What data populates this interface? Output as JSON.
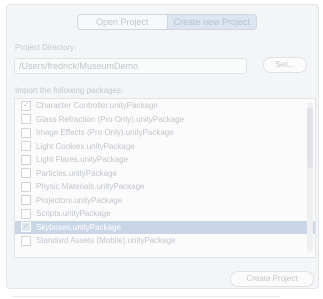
{
  "tabs": [
    {
      "label": "Open Project",
      "active": false
    },
    {
      "label": "Create new Project",
      "active": true
    }
  ],
  "project_directory": {
    "label": "Project Directory:",
    "value": "/Users/fredrick/MuseumDemo",
    "set_label": "Set..."
  },
  "packages": {
    "label": "Import the following packages:",
    "items": [
      {
        "label": "Character Controller.unityPackage",
        "checked": true,
        "selected": false
      },
      {
        "label": "Glass Refraction (Pro Only).unityPackage",
        "checked": false,
        "selected": false
      },
      {
        "label": "Image Effects (Pro Only).unityPackage",
        "checked": false,
        "selected": false
      },
      {
        "label": "Light Cookies.unityPackage",
        "checked": false,
        "selected": false
      },
      {
        "label": "Light Flares.unityPackage",
        "checked": false,
        "selected": false
      },
      {
        "label": "Particles.unityPackage",
        "checked": false,
        "selected": false
      },
      {
        "label": "Physic Materials.unityPackage",
        "checked": false,
        "selected": false
      },
      {
        "label": "Projectors.unityPackage",
        "checked": false,
        "selected": false
      },
      {
        "label": "Scripts.unityPackage",
        "checked": false,
        "selected": false
      },
      {
        "label": "Skyboxes.unityPackage",
        "checked": true,
        "selected": true
      },
      {
        "label": "Standard Assets (Mobile).unityPackage",
        "checked": false,
        "selected": false
      }
    ]
  },
  "create_label": "Create Project",
  "colors": {
    "selection": "#c9d6e8",
    "active_tab": "#dbe6f2"
  }
}
